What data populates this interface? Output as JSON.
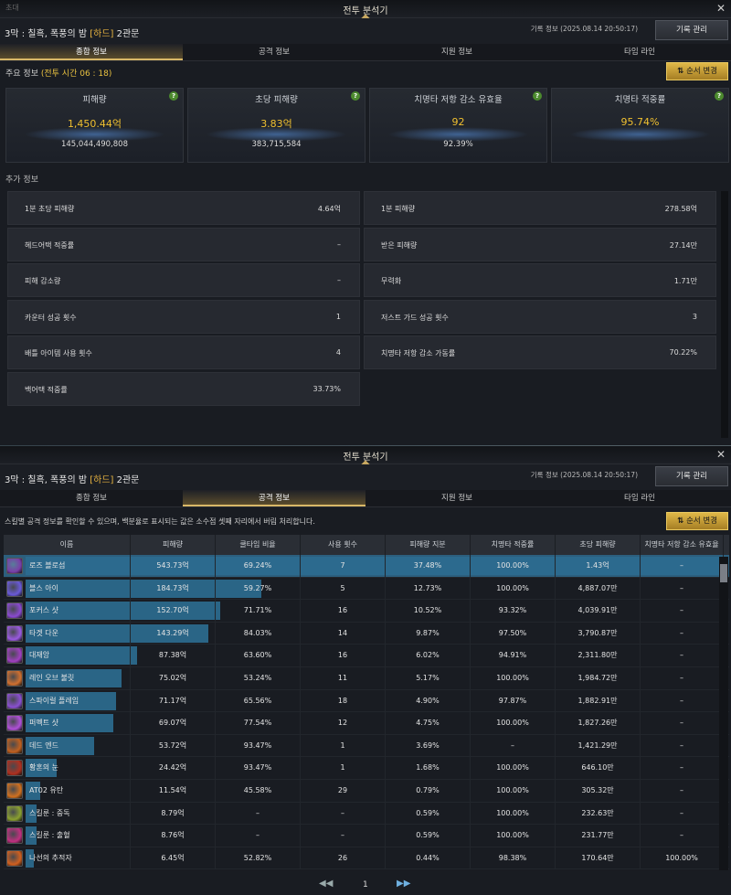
{
  "window_title": "전투 분석기",
  "ghost_label": "초대",
  "stage": {
    "prefix": "3막 : 칠흑, 폭풍의 밤",
    "diff": "[하드]",
    "gate": "2관문"
  },
  "record": "기록 정보 (2025.08.14 20:50:17)",
  "manage_btn": "기록 관리",
  "tabs": [
    "종합 정보",
    "공격 정보",
    "지원 정보",
    "타임 라인"
  ],
  "summary": {
    "label": "주요 정보",
    "time": "(전투 시간 06 : 18)",
    "sort_btn": "순서 변경",
    "cards": [
      {
        "name": "피해량",
        "value": "1,450.44억",
        "sub": "145,044,490,808"
      },
      {
        "name": "초당 피해량",
        "value": "3.83억",
        "sub": "383,715,584"
      },
      {
        "name": "치명타 저항 감소 유효율",
        "value": "92",
        "sub": "92.39%"
      },
      {
        "name": "치명타 적중률",
        "value": "95.74%",
        "sub": ""
      }
    ]
  },
  "extra": {
    "label": "추가 정보",
    "items": [
      {
        "k": "1분 초당 피해량",
        "v": "4.64억"
      },
      {
        "k": "1분 피해량",
        "v": "278.58억"
      },
      {
        "k": "헤드어택 적중률",
        "v": "–"
      },
      {
        "k": "받은 피해량",
        "v": "27.14만"
      },
      {
        "k": "피해 감소량",
        "v": "–"
      },
      {
        "k": "무력화",
        "v": "1.71만"
      },
      {
        "k": "카운터 성공 횟수",
        "v": "1"
      },
      {
        "k": "저스트 가드 성공 횟수",
        "v": "3"
      },
      {
        "k": "배틀 아이템 사용 횟수",
        "v": "4"
      },
      {
        "k": "치명타 저항 감소 가동률",
        "v": "70.22%"
      },
      {
        "k": "백어택 적중률",
        "v": "33.73%"
      }
    ]
  },
  "attack": {
    "note": "스킬별 공격 정보를 확인할 수 있으며, 백분율로 표시되는 값은 소수점 셋째 자리에서 버림 처리합니다.",
    "sort_btn": "순서 변경",
    "headers": [
      "이름",
      "피해량",
      "쿨타임 비율",
      "사용 횟수",
      "피해량 지분",
      "치명타 적중률",
      "초당 피해량",
      "치명타 저항 감소 유효율"
    ],
    "rows": [
      {
        "n": "로즈 블로섬",
        "d": "543.73억",
        "cd": "69.24%",
        "u": "7",
        "sh": "37.48%",
        "cr": "100.00%",
        "dps": "1.43억",
        "cv": "–",
        "share": 1.0,
        "col": "#7a3ea8"
      },
      {
        "n": "블스 아이",
        "d": "184.73억",
        "cd": "59.27%",
        "u": "5",
        "sh": "12.73%",
        "cr": "100.00%",
        "dps": "4,887.07만",
        "cv": "–",
        "share": 0.3397,
        "col": "#6a5ad8"
      },
      {
        "n": "포커스 샷",
        "d": "152.70억",
        "cd": "71.71%",
        "u": "16",
        "sh": "10.52%",
        "cr": "93.32%",
        "dps": "4,039.91만",
        "cv": "–",
        "share": 0.2808,
        "col": "#8a4ad0"
      },
      {
        "n": "타겟 다운",
        "d": "143.29억",
        "cd": "84.03%",
        "u": "14",
        "sh": "9.87%",
        "cr": "97.50%",
        "dps": "3,790.87만",
        "cv": "–",
        "share": 0.2635,
        "col": "#9a5ae0"
      },
      {
        "n": "대재앙",
        "d": "87.38억",
        "cd": "63.60%",
        "u": "16",
        "sh": "6.02%",
        "cr": "94.91%",
        "dps": "2,311.80만",
        "cv": "–",
        "share": 0.1607,
        "col": "#a040c0"
      },
      {
        "n": "레인 오브 불릿",
        "d": "75.02억",
        "cd": "53.24%",
        "u": "11",
        "sh": "5.17%",
        "cr": "100.00%",
        "dps": "1,984.72만",
        "cv": "–",
        "share": 0.138,
        "col": "#d07030"
      },
      {
        "n": "스파이럴 플레임",
        "d": "71.17억",
        "cd": "65.56%",
        "u": "18",
        "sh": "4.90%",
        "cr": "97.87%",
        "dps": "1,882.91만",
        "cv": "–",
        "share": 0.1309,
        "col": "#8a50d0"
      },
      {
        "n": "퍼펙트 샷",
        "d": "69.07억",
        "cd": "77.54%",
        "u": "12",
        "sh": "4.75%",
        "cr": "100.00%",
        "dps": "1,827.26만",
        "cv": "–",
        "share": 0.127,
        "col": "#b050d8"
      },
      {
        "n": "데드 엔드",
        "d": "53.72억",
        "cd": "93.47%",
        "u": "1",
        "sh": "3.69%",
        "cr": "–",
        "dps": "1,421.29만",
        "cv": "–",
        "share": 0.0988,
        "col": "#c06020"
      },
      {
        "n": "황혼의 눈",
        "d": "24.42억",
        "cd": "93.47%",
        "u": "1",
        "sh": "1.68%",
        "cr": "100.00%",
        "dps": "646.10만",
        "cv": "–",
        "share": 0.0449,
        "col": "#b03020"
      },
      {
        "n": "AT02 유탄",
        "d": "11.54억",
        "cd": "45.58%",
        "u": "29",
        "sh": "0.79%",
        "cr": "100.00%",
        "dps": "305.32만",
        "cv": "–",
        "share": 0.0212,
        "col": "#d07020"
      },
      {
        "n": "스킬룬 : 중독",
        "d": "8.79억",
        "cd": "–",
        "u": "–",
        "sh": "0.59%",
        "cr": "100.00%",
        "dps": "232.63만",
        "cv": "–",
        "share": 0.0162,
        "col": "#8aa030"
      },
      {
        "n": "스킬룬 : 출혈",
        "d": "8.76억",
        "cd": "–",
        "u": "–",
        "sh": "0.59%",
        "cr": "100.00%",
        "dps": "231.77만",
        "cv": "–",
        "share": 0.0161,
        "col": "#c03080"
      },
      {
        "n": "나선의 추적자",
        "d": "6.45억",
        "cd": "52.82%",
        "u": "26",
        "sh": "0.44%",
        "cr": "98.38%",
        "dps": "170.64만",
        "cv": "100.00%",
        "share": 0.0119,
        "col": "#d06020"
      }
    ]
  },
  "pager": {
    "prev": "◀◀",
    "page": "1",
    "next": "▶▶"
  }
}
